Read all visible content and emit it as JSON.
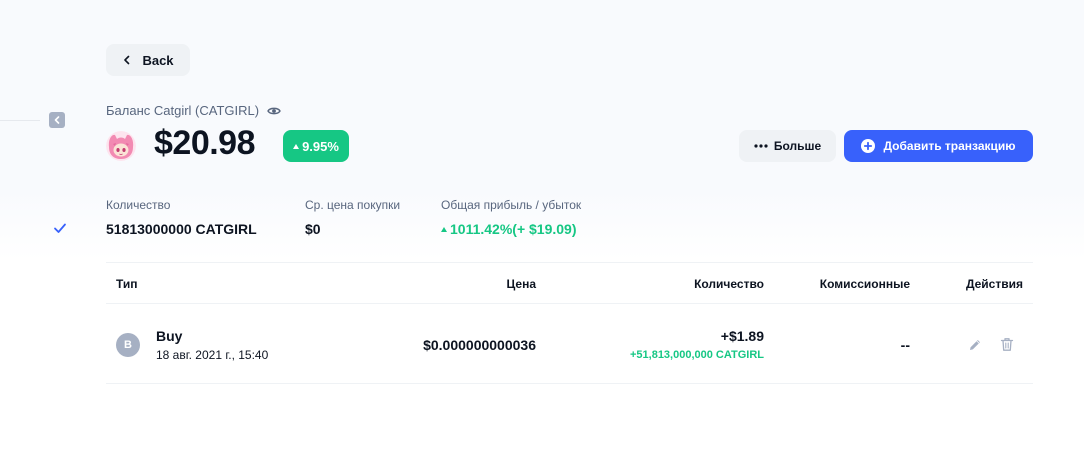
{
  "nav": {
    "back_label": "Back"
  },
  "header": {
    "balance_label": "Баланс Catgirl (CATGIRL)",
    "balance_value": "$20.98",
    "change_pct": "9.95%",
    "more_label": "Больше",
    "add_transaction_label": "Добавить транзакцию"
  },
  "stats": {
    "quantity": {
      "label": "Количество",
      "value": "51813000000 CATGIRL"
    },
    "avg_price": {
      "label": "Ср. цена покупки",
      "value": "$0"
    },
    "pnl": {
      "label": "Общая прибыль / убыток",
      "value": "1011.42%(+ $19.09)"
    }
  },
  "table": {
    "headers": {
      "type": "Тип",
      "price": "Цена",
      "quantity": "Количество",
      "fees": "Комиссионные",
      "actions": "Действия"
    },
    "rows": [
      {
        "avatar_letter": "B",
        "type": "Buy",
        "date": "18 авг. 2021 г., 15:40",
        "price": "$0.000000000036",
        "quantity_usd": "+$1.89",
        "quantity_coin": "+51,813,000,000 CATGIRL",
        "fees": "--"
      }
    ]
  },
  "icons": {
    "back": "chevron-left-icon",
    "eye": "eye-icon",
    "more": "ellipsis-icon",
    "add": "plus-circle-icon",
    "edit": "pencil-icon",
    "delete": "trash-icon",
    "check": "check-icon"
  },
  "colors": {
    "accent": "#3861fb",
    "positive": "#16c784",
    "muted": "#58667e",
    "button_bg": "#eff2f5"
  }
}
